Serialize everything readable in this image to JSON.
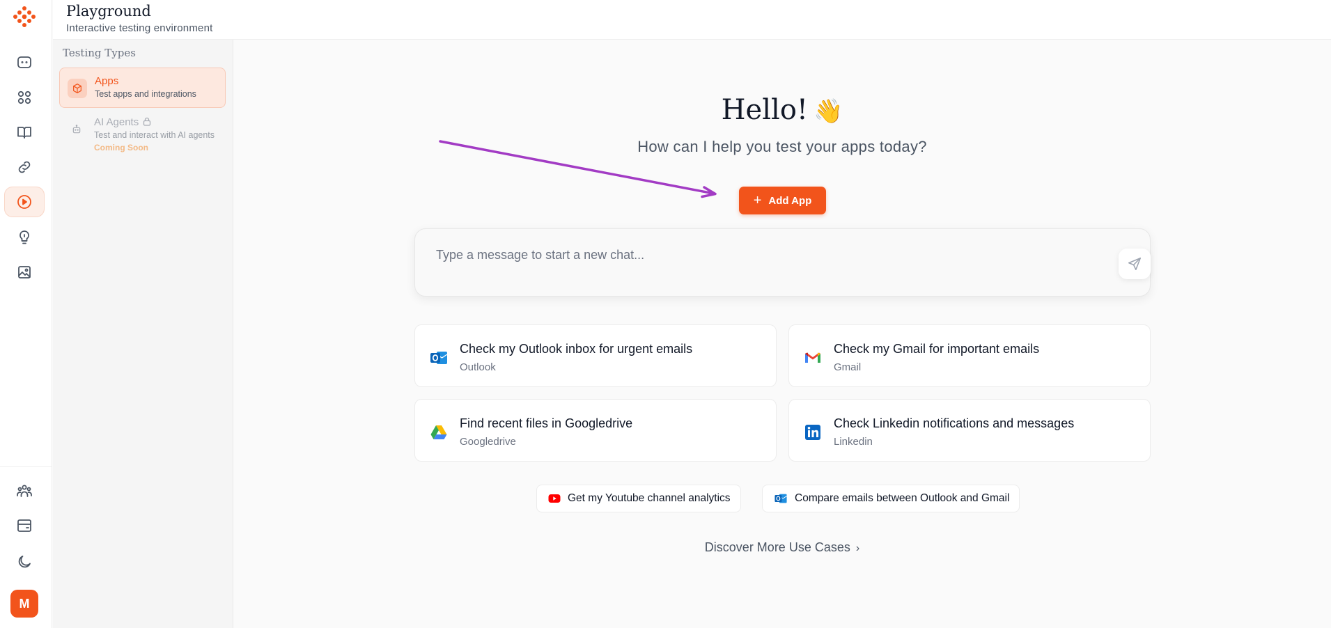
{
  "header": {
    "title": "Playground",
    "subtitle": "Interactive testing environment"
  },
  "rail": {
    "items": [
      {
        "icon": "chat-icon"
      },
      {
        "icon": "apps-grid-icon"
      },
      {
        "icon": "book-icon"
      },
      {
        "icon": "link-icon"
      },
      {
        "icon": "play-circle-icon",
        "active": true
      },
      {
        "icon": "lightbulb-icon"
      },
      {
        "icon": "image-icon"
      }
    ],
    "bottom": [
      {
        "icon": "users-icon"
      },
      {
        "icon": "wallet-icon"
      },
      {
        "icon": "moon-icon"
      }
    ],
    "avatar_initial": "M"
  },
  "sidebar": {
    "section_title": "Testing Types",
    "items": [
      {
        "label": "Apps",
        "desc": "Test apps and integrations",
        "active": true
      },
      {
        "label": "AI Agents",
        "desc": "Test and interact with AI agents",
        "badge": "Coming Soon",
        "locked": true
      }
    ]
  },
  "main": {
    "greeting": "Hello!",
    "greeting_emoji": "👋",
    "lead": "How can I help you test your apps today?",
    "add_app_label": "Add App",
    "chat_placeholder": "Type a message to start a new chat...",
    "cards": [
      {
        "title": "Check my Outlook inbox for urgent emails",
        "sub": "Outlook",
        "icon": "outlook-icon"
      },
      {
        "title": "Check my Gmail for important emails",
        "sub": "Gmail",
        "icon": "gmail-icon"
      },
      {
        "title": "Find recent files in Googledrive",
        "sub": "Googledrive",
        "icon": "google-drive-icon"
      },
      {
        "title": "Check Linkedin notifications and messages",
        "sub": "Linkedin",
        "icon": "linkedin-icon"
      }
    ],
    "chips": [
      {
        "label": "Get my Youtube channel analytics",
        "icon": "youtube-icon"
      },
      {
        "label": "Compare emails between Outlook and Gmail",
        "icon": "outlook-icon"
      }
    ],
    "discover_label": "Discover More Use Cases"
  },
  "colors": {
    "accent": "#f2541b",
    "annotation_arrow": "#a23bc4"
  }
}
